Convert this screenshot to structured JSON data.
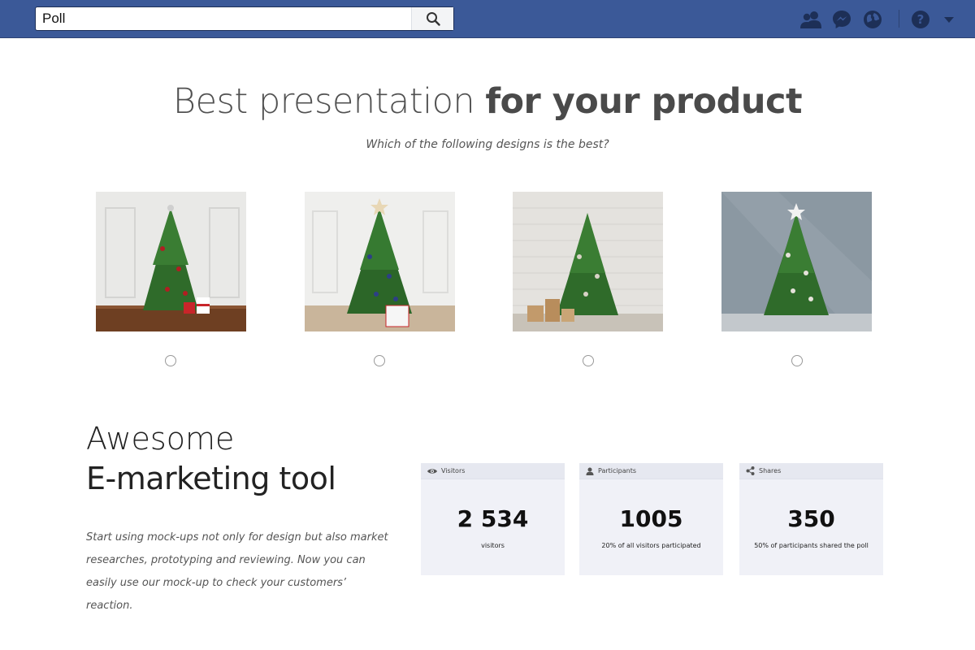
{
  "search": {
    "value": "Poll"
  },
  "heading": {
    "light": "Best presentation ",
    "bold": "for your product"
  },
  "subheading": "Which of the following designs is the best?",
  "options": [
    {
      "name": "tree-design-1"
    },
    {
      "name": "tree-design-2"
    },
    {
      "name": "tree-design-3"
    },
    {
      "name": "tree-design-4"
    }
  ],
  "marketing": {
    "line1": "Awesome",
    "line2": "E-marketing tool",
    "description": "Start using mock-ups not only for design but also market researches, prototyping and reviewing. Now you can easily use our mock-up to check your customers’ reaction."
  },
  "stats": [
    {
      "label": "Visitors",
      "value": "2 534",
      "caption": "visitors",
      "icon": "eye-icon"
    },
    {
      "label": "Participants",
      "value": "1005",
      "caption": "20% of all visitors participated",
      "icon": "person-icon"
    },
    {
      "label": "Shares",
      "value": "350",
      "caption": "50% of participants shared the poll",
      "icon": "share-icon"
    }
  ],
  "icons": [
    "search-icon",
    "friends-icon",
    "messenger-icon",
    "globe-icon",
    "help-icon",
    "caret-down-icon"
  ],
  "colors": {
    "topbar": "#3b5998",
    "card": "#f0f1f7",
    "cardHeader": "#e6e8f0",
    "tree": "#2f6b2a"
  }
}
